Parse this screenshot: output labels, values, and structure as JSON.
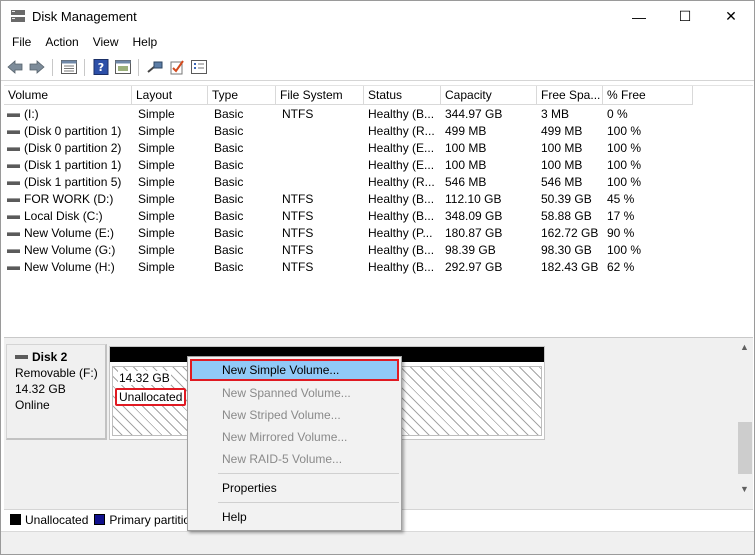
{
  "window": {
    "title": "Disk Management",
    "controls": {
      "minimize": "—",
      "maximize": "☐",
      "close": "✕"
    }
  },
  "menu": [
    "File",
    "Action",
    "View",
    "Help"
  ],
  "toolbar_icons": [
    "back-arrow-icon",
    "forward-arrow-icon",
    "list-view-icon",
    "help-book-icon",
    "panel-icon",
    "connect-icon",
    "checkmark-icon",
    "properties-icon"
  ],
  "columns": [
    "Volume",
    "Layout",
    "Type",
    "File System",
    "Status",
    "Capacity",
    "Free Spa...",
    "% Free"
  ],
  "volumes": [
    [
      "(I:)",
      "Simple",
      "Basic",
      "NTFS",
      "Healthy (B...",
      "344.97 GB",
      "3 MB",
      "0 %"
    ],
    [
      "(Disk 0 partition 1)",
      "Simple",
      "Basic",
      "",
      "Healthy (R...",
      "499 MB",
      "499 MB",
      "100 %"
    ],
    [
      "(Disk 0 partition 2)",
      "Simple",
      "Basic",
      "",
      "Healthy (E...",
      "100 MB",
      "100 MB",
      "100 %"
    ],
    [
      "(Disk 1 partition 1)",
      "Simple",
      "Basic",
      "",
      "Healthy (E...",
      "100 MB",
      "100 MB",
      "100 %"
    ],
    [
      "(Disk 1 partition 5)",
      "Simple",
      "Basic",
      "",
      "Healthy (R...",
      "546 MB",
      "546 MB",
      "100 %"
    ],
    [
      "FOR WORK (D:)",
      "Simple",
      "Basic",
      "NTFS",
      "Healthy (B...",
      "112.10 GB",
      "50.39 GB",
      "45 %"
    ],
    [
      "Local Disk (C:)",
      "Simple",
      "Basic",
      "NTFS",
      "Healthy (B...",
      "348.09 GB",
      "58.88 GB",
      "17 %"
    ],
    [
      "New Volume (E:)",
      "Simple",
      "Basic",
      "NTFS",
      "Healthy (P...",
      "180.87 GB",
      "162.72 GB",
      "90 %"
    ],
    [
      "New Volume (G:)",
      "Simple",
      "Basic",
      "NTFS",
      "Healthy (B...",
      "98.39 GB",
      "98.30 GB",
      "100 %"
    ],
    [
      "New Volume (H:)",
      "Simple",
      "Basic",
      "NTFS",
      "Healthy (B...",
      "292.97 GB",
      "182.43 GB",
      "62 %"
    ]
  ],
  "disk": {
    "name": "Disk 2",
    "type": "Removable (F:)",
    "size": "14.32 GB",
    "state": "Online",
    "partition": {
      "size": "14.32 GB",
      "label": "Unallocated"
    }
  },
  "legend": {
    "unallocated": "Unallocated",
    "primary": "Primary partitio"
  },
  "context_menu": {
    "items": [
      {
        "label": "New Simple Volume...",
        "enabled": true,
        "highlighted": true
      },
      {
        "label": "New Spanned Volume...",
        "enabled": false
      },
      {
        "label": "New Striped Volume...",
        "enabled": false
      },
      {
        "label": "New Mirrored Volume...",
        "enabled": false
      },
      {
        "label": "New RAID-5 Volume...",
        "enabled": false
      }
    ],
    "properties": "Properties",
    "help": "Help"
  },
  "colors": {
    "highlight": "#91c9f7",
    "annotation_red": "#e01a22",
    "primary_partition": "#10108c"
  }
}
